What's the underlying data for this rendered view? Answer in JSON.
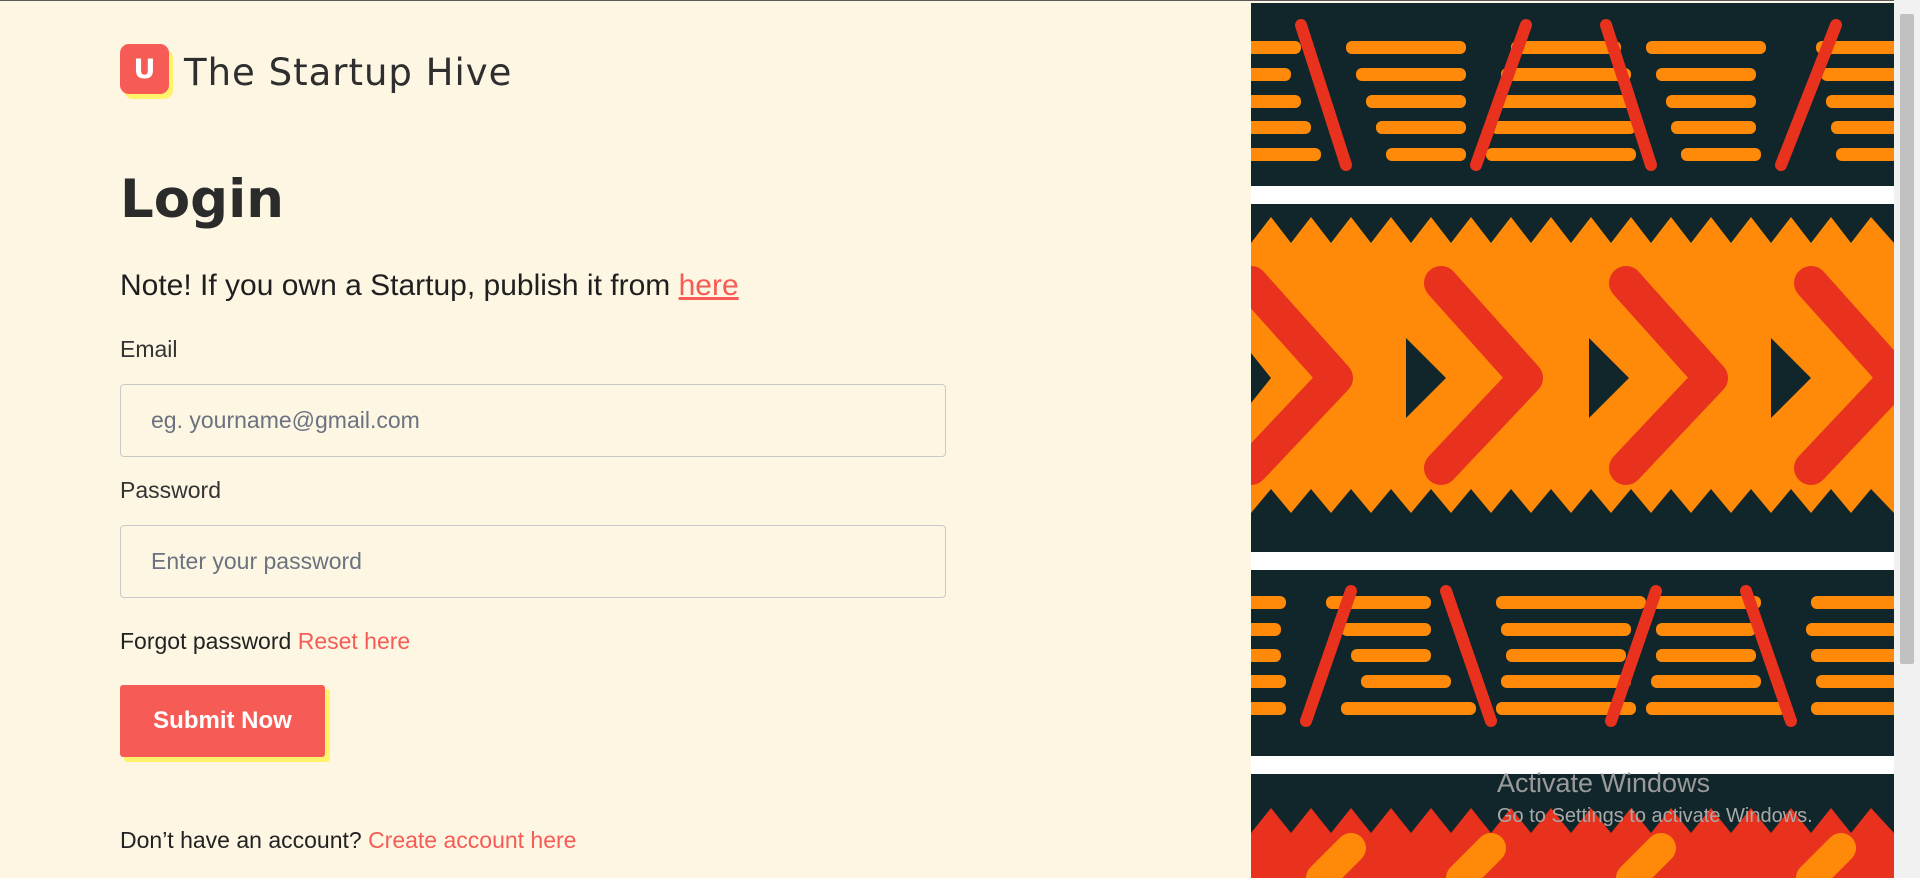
{
  "brand": {
    "logo_letter": "U",
    "name": "The Startup Hive",
    "accent": "#f75b55",
    "highlight": "#fff36b"
  },
  "login": {
    "title": "Login",
    "note_text": "Note! If you own a Startup, publish it from ",
    "note_link": "here",
    "email_label": "Email",
    "email_placeholder": "eg. yourname@gmail.com",
    "password_label": "Password",
    "password_placeholder": "Enter your password",
    "forgot_text": "Forgot password ",
    "reset_link": "Reset here",
    "submit_label": "Submit Now",
    "signup_text": "Don’t have an account? ",
    "signup_link": "Create account here"
  },
  "decor": {
    "pattern": "tribal-pattern-image",
    "colors": [
      "#ff8a0a",
      "#e8321e",
      "#11262b",
      "#ffffff"
    ]
  },
  "watermark": {
    "title": "Activate Windows",
    "subtitle": "Go to Settings to activate Windows."
  }
}
